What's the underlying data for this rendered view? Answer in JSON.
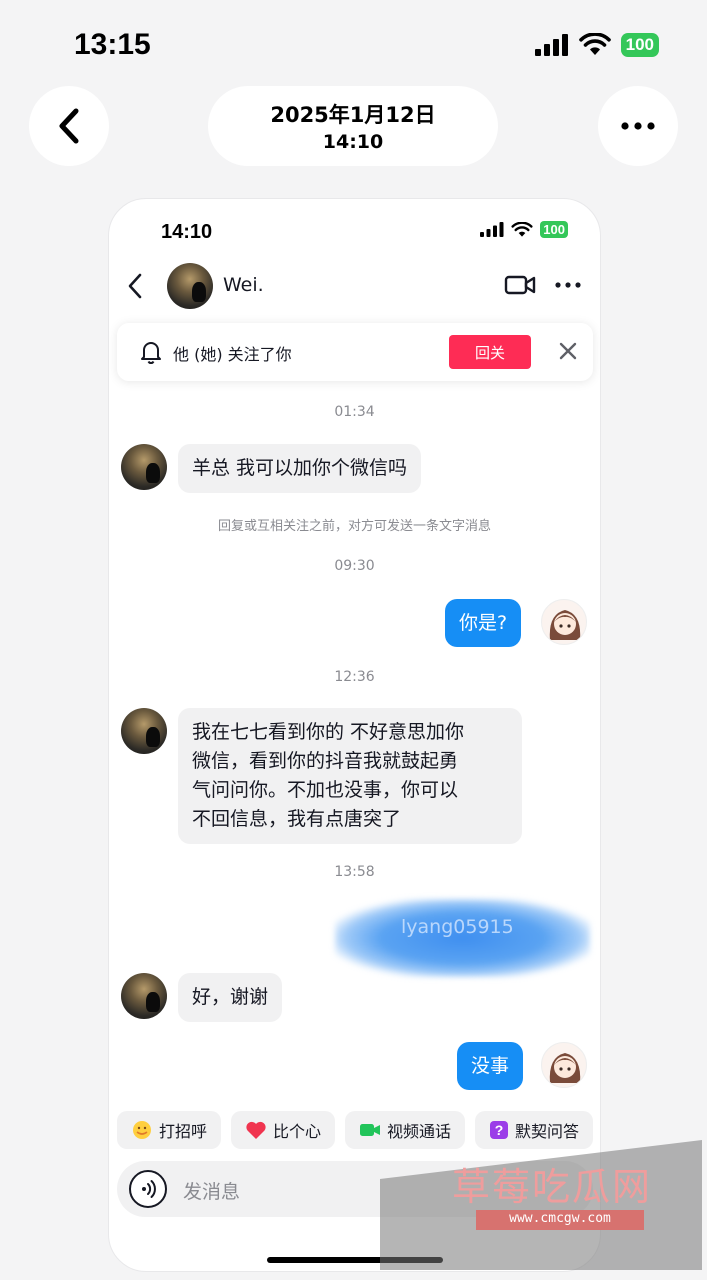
{
  "outer_status": {
    "time": "13:15",
    "battery": "100"
  },
  "record_header": {
    "date": "2025年1月12日",
    "time": "14:10"
  },
  "inner_status": {
    "time": "14:10",
    "battery": "100"
  },
  "chat": {
    "contact_name": "Wei.",
    "follow_banner": {
      "text": "他 (她) 关注了你",
      "button": "回关"
    },
    "messages": [
      {
        "type": "timestamp",
        "text": "01:34"
      },
      {
        "type": "incoming",
        "text": "羊总 我可以加你个微信吗"
      },
      {
        "type": "notice",
        "text": "回复或互相关注之前，对方可发送一条文字消息"
      },
      {
        "type": "timestamp",
        "text": "09:30"
      },
      {
        "type": "outgoing",
        "text": "你是?"
      },
      {
        "type": "timestamp",
        "text": "12:36"
      },
      {
        "type": "incoming",
        "lines": [
          "我在七七看到你的 不好意思加你",
          "微信，看到你的抖音我就鼓起勇",
          "气问问你。不加也没事，你可以",
          "不回信息，我有点唐突了"
        ]
      },
      {
        "type": "timestamp",
        "text": "13:58"
      },
      {
        "type": "outgoing_redacted",
        "text": "lyang05915"
      },
      {
        "type": "incoming",
        "text": "好，谢谢"
      },
      {
        "type": "outgoing",
        "text": "没事"
      }
    ],
    "quick_actions": [
      "打招呼",
      "比个心",
      "视频通话",
      "默契问答"
    ],
    "input_placeholder": "发消息"
  },
  "watermark": {
    "title": "草莓吃瓜网",
    "url": "www.cmcgw.com"
  },
  "colors": {
    "accent_red": "#fe2c55",
    "bubble_blue": "#168ef5",
    "battery_green": "#34c759"
  }
}
